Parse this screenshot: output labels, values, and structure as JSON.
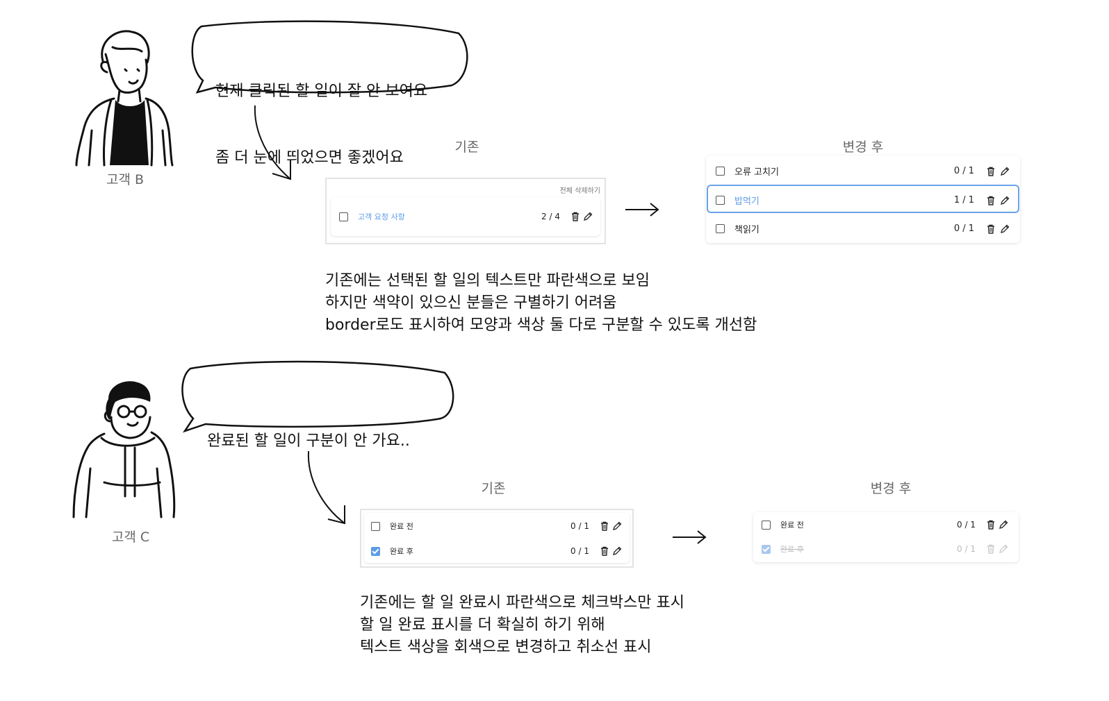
{
  "customer_b": {
    "label": "고객 B",
    "bubble_line1": "현재 클릭된 할 일이 잘 안 보여요",
    "bubble_line2": "좀 더 눈에 띄었으면 좋겠어요"
  },
  "customer_c": {
    "label": "고객 C",
    "bubble_line1": "완료된 할 일이 구분이 안 가요.."
  },
  "section1": {
    "before_title": "기존",
    "after_title": "변경 후",
    "before_panel": {
      "delete_all_label": "전체 삭제하기",
      "item": {
        "label": "고객 요청 사항",
        "count": "2 / 4"
      }
    },
    "after_panel": {
      "items": [
        {
          "label": "오류 고치기",
          "count": "0 / 1"
        },
        {
          "label": "밥먹기",
          "count": "1 / 1"
        },
        {
          "label": "책읽기",
          "count": "0 / 1"
        }
      ]
    },
    "description": [
      "기존에는 선택된 할 일의 텍스트만 파란색으로 보임",
      "하지만 색약이 있으신 분들은 구별하기 어려움",
      "border로도 표시하여 모양과 색상 둘 다로 구분할 수 있도록 개선함"
    ]
  },
  "section2": {
    "before_title": "기존",
    "after_title": "변경 후",
    "before_panel": {
      "items": [
        {
          "label": "완료 전",
          "count": "0 / 1"
        },
        {
          "label": "완료 후",
          "count": "0 / 1"
        }
      ]
    },
    "after_panel": {
      "items": [
        {
          "label": "완료 전",
          "count": "0 / 1"
        },
        {
          "label": "완료 후",
          "count": "0 / 1"
        }
      ]
    },
    "description": [
      "기존에는 할 일 완료시 파란색으로 체크박스만 표시",
      "할 일 완료 표시를 더 확실히 하기 위해",
      "텍스트 색상을 회색으로 변경하고 취소선 표시"
    ]
  },
  "icons": {
    "delete": "trash-icon",
    "edit": "pencil-icon",
    "checkbox": "checkbox-icon"
  },
  "colors": {
    "accent_blue": "#5b9be8",
    "selected_border": "#6aa3ea",
    "done_text": "#bbbbbb",
    "label_gray": "#666666"
  }
}
